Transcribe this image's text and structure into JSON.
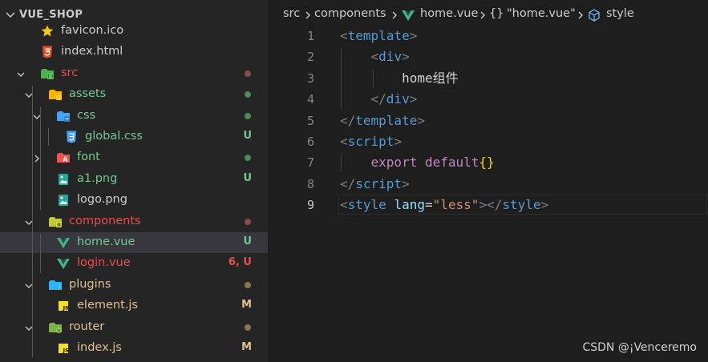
{
  "explorer": {
    "title": "VUE_SHOP",
    "items": [
      {
        "name": "favicon.ico",
        "icon": "star-icon",
        "color": "#cccccc",
        "status": "",
        "dot": ""
      },
      {
        "name": "index.html",
        "icon": "html5-icon",
        "color": "#cccccc",
        "status": "",
        "dot": ""
      },
      {
        "name": "src",
        "icon": "folder-src-icon",
        "color": "#f14c4c",
        "status": "",
        "dot": "#8b4a4a"
      },
      {
        "name": "assets",
        "icon": "folder-assets-icon",
        "color": "#73c991",
        "status": "",
        "dot": "#4b8b5a"
      },
      {
        "name": "css",
        "icon": "folder-css-icon",
        "color": "#73c991",
        "status": "",
        "dot": "#4b8b5a"
      },
      {
        "name": "global.css",
        "icon": "css3-icon",
        "color": "#73c991",
        "status": "U",
        "dot": ""
      },
      {
        "name": "font",
        "icon": "folder-font-icon",
        "color": "#73c991",
        "status": "",
        "dot": "#4b8b5a"
      },
      {
        "name": "a1.png",
        "icon": "image-icon",
        "color": "#73c991",
        "status": "U",
        "dot": ""
      },
      {
        "name": "logo.png",
        "icon": "image-icon",
        "color": "#cccccc",
        "status": "",
        "dot": ""
      },
      {
        "name": "components",
        "icon": "folder-components-icon",
        "color": "#f14c4c",
        "status": "",
        "dot": "#8b4a4a"
      },
      {
        "name": "home.vue",
        "icon": "vue-icon",
        "color": "#73c991",
        "status": "U",
        "dot": ""
      },
      {
        "name": "login.vue",
        "icon": "vue-icon",
        "color": "#f14c4c",
        "status": "6, U",
        "dot": ""
      },
      {
        "name": "plugins",
        "icon": "folder-plugins-icon",
        "color": "#e2c08d",
        "status": "",
        "dot": "#8a7550"
      },
      {
        "name": "element.js",
        "icon": "js-icon",
        "color": "#e2c08d",
        "status": "M",
        "dot": ""
      },
      {
        "name": "router",
        "icon": "folder-router-icon",
        "color": "#e2c08d",
        "status": "",
        "dot": "#8a7550"
      },
      {
        "name": "index.js",
        "icon": "js-icon",
        "color": "#e2c08d",
        "status": "M",
        "dot": ""
      }
    ]
  },
  "breadcrumb": {
    "items": [
      {
        "label": "src",
        "icon": ""
      },
      {
        "label": "components",
        "icon": ""
      },
      {
        "label": "home.vue",
        "icon": "vue-icon"
      },
      {
        "label": "\"home.vue\"",
        "icon": "braces-icon"
      },
      {
        "label": "style",
        "icon": "cube-icon"
      }
    ],
    "braces_glyph": "{}"
  },
  "editor": {
    "line_numbers": [
      "1",
      "2",
      "3",
      "4",
      "5",
      "6",
      "7",
      "8",
      "9"
    ],
    "active_line": "9",
    "lines": [
      [
        [
          "<",
          "punc"
        ],
        [
          "template",
          "tag"
        ],
        [
          ">",
          "punc"
        ]
      ],
      [
        [
          "    ",
          "text"
        ],
        [
          "<",
          "punc"
        ],
        [
          "div",
          "tag"
        ],
        [
          ">",
          "punc"
        ]
      ],
      [
        [
          "        ",
          "text"
        ],
        [
          "home组件",
          "text"
        ]
      ],
      [
        [
          "    ",
          "text"
        ],
        [
          "</",
          "punc"
        ],
        [
          "div",
          "tag"
        ],
        [
          ">",
          "punc"
        ]
      ],
      [
        [
          "</",
          "punc"
        ],
        [
          "template",
          "tag"
        ],
        [
          ">",
          "punc"
        ]
      ],
      [
        [
          "<",
          "punc"
        ],
        [
          "script",
          "tag"
        ],
        [
          ">",
          "punc"
        ]
      ],
      [
        [
          "    ",
          "text"
        ],
        [
          "export",
          "kw"
        ],
        [
          " ",
          "text"
        ],
        [
          "default",
          "kw"
        ],
        [
          "{}",
          "brace"
        ]
      ],
      [
        [
          "</",
          "punc"
        ],
        [
          "script",
          "tag"
        ],
        [
          ">",
          "punc"
        ]
      ],
      [
        [
          "<",
          "punc"
        ],
        [
          "style",
          "tag"
        ],
        [
          " ",
          "text"
        ],
        [
          "lang",
          "attr"
        ],
        [
          "=",
          "text"
        ],
        [
          "\"less\"",
          "str"
        ],
        [
          "></",
          "punc"
        ],
        [
          "style",
          "tag"
        ],
        [
          ">",
          "punc"
        ]
      ]
    ]
  },
  "watermark": "CSDN @¡Venceremo",
  "colors": {
    "sidebar_bg": "#252526",
    "editor_bg": "#1e1e1e",
    "selected_row": "#37373d",
    "untracked_green": "#73c991",
    "error_red": "#f14c4c",
    "modified_yellow": "#e2c08d"
  }
}
